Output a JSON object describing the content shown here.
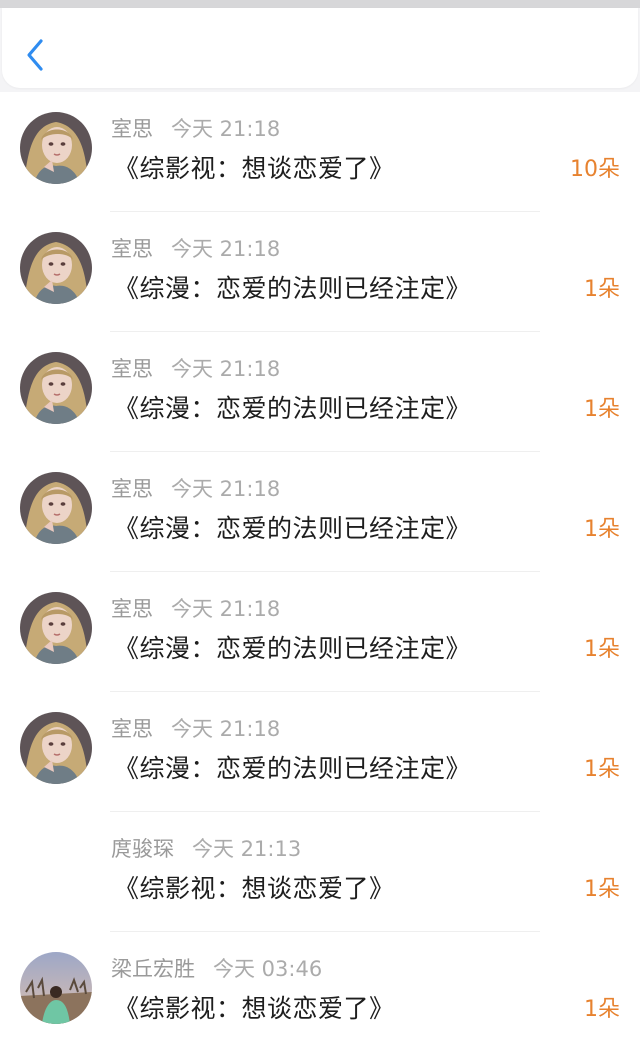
{
  "colors": {
    "accent_blue": "#2f8cf0",
    "count_orange": "#e7822f",
    "name_gray": "#9a9a9a"
  },
  "header": {
    "back_icon": "chevron-left-icon"
  },
  "entries": [
    {
      "user": "室思",
      "time": "今天 21:18",
      "book": "《综影视：想谈恋爱了》",
      "count": "10朵",
      "avatar": "anime-girl-avatar"
    },
    {
      "user": "室思",
      "time": "今天 21:18",
      "book": "《综漫：恋爱的法则已经注定》",
      "count": "1朵",
      "avatar": "anime-girl-avatar"
    },
    {
      "user": "室思",
      "time": "今天 21:18",
      "book": "《综漫：恋爱的法则已经注定》",
      "count": "1朵",
      "avatar": "anime-girl-avatar"
    },
    {
      "user": "室思",
      "time": "今天 21:18",
      "book": "《综漫：恋爱的法则已经注定》",
      "count": "1朵",
      "avatar": "anime-girl-avatar"
    },
    {
      "user": "室思",
      "time": "今天 21:18",
      "book": "《综漫：恋爱的法则已经注定》",
      "count": "1朵",
      "avatar": "anime-girl-avatar"
    },
    {
      "user": "室思",
      "time": "今天 21:18",
      "book": "《综漫：恋爱的法则已经注定》",
      "count": "1朵",
      "avatar": "anime-girl-avatar"
    },
    {
      "user": "庹骏琛",
      "time": "今天 21:13",
      "book": "《综影视：想谈恋爱了》",
      "count": "1朵",
      "avatar": "blank-avatar"
    },
    {
      "user": "梁丘宏胜",
      "time": "今天 03:46",
      "book": "《综影视：想谈恋爱了》",
      "count": "1朵",
      "avatar": "photo-avatar"
    }
  ]
}
